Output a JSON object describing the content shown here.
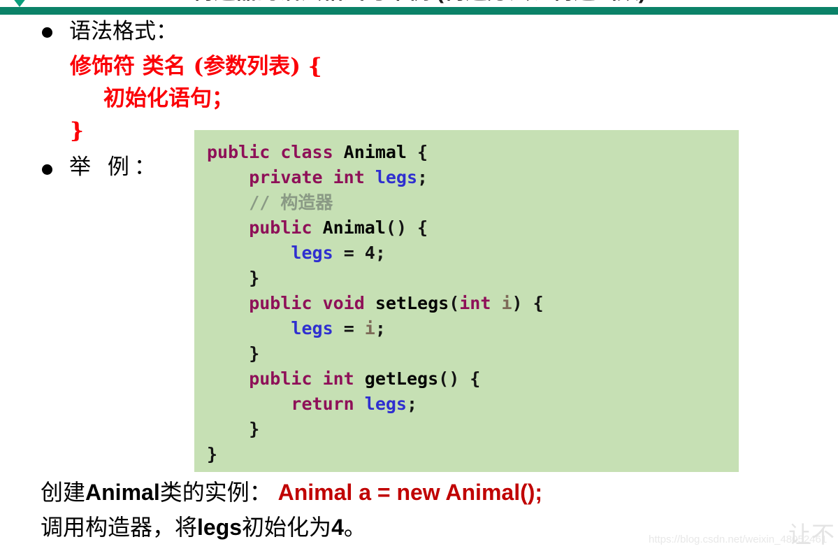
{
  "slide": {
    "title_clipped": "构造器的语法格式与举例 (构造方法、构造函数)",
    "accent_color": "#0b8268",
    "red_color": "#fb0007",
    "code_bg_color": "#c6e0b4",
    "dark_red_color": "#c00000"
  },
  "bullets": {
    "syntax_label": "语法格式：",
    "example_label": "举 例："
  },
  "syntax_template": {
    "line1": "修饰符  类名 (参数列表) {",
    "line2": "初始化语句；",
    "line3": "}"
  },
  "code": {
    "language": "java",
    "lines": [
      [
        {
          "t": "public class ",
          "c": "kw"
        },
        {
          "t": "Animal ",
          "c": "fn"
        },
        {
          "t": "{",
          "c": "plain"
        }
      ],
      [
        {
          "t": "    private int ",
          "c": "kw"
        },
        {
          "t": "legs",
          "c": "var"
        },
        {
          "t": ";",
          "c": "plain"
        }
      ],
      [
        {
          "t": "    // 构造器",
          "c": "comment"
        }
      ],
      [
        {
          "t": "    public ",
          "c": "kw"
        },
        {
          "t": "Animal",
          "c": "fn"
        },
        {
          "t": "() {",
          "c": "plain"
        }
      ],
      [
        {
          "t": "        ",
          "c": "plain"
        },
        {
          "t": "legs",
          "c": "var"
        },
        {
          "t": " = 4;",
          "c": "plain"
        }
      ],
      [
        {
          "t": "    }",
          "c": "plain"
        }
      ],
      [
        {
          "t": "    public void ",
          "c": "kw"
        },
        {
          "t": "setLegs",
          "c": "fn"
        },
        {
          "t": "(",
          "c": "plain"
        },
        {
          "t": "int ",
          "c": "kw"
        },
        {
          "t": "i",
          "c": "param"
        },
        {
          "t": ") {",
          "c": "plain"
        }
      ],
      [
        {
          "t": "        ",
          "c": "plain"
        },
        {
          "t": "legs",
          "c": "var"
        },
        {
          "t": " = ",
          "c": "plain"
        },
        {
          "t": "i",
          "c": "param"
        },
        {
          "t": ";",
          "c": "plain"
        }
      ],
      [
        {
          "t": "    }",
          "c": "plain"
        }
      ],
      [
        {
          "t": "    public int ",
          "c": "kw"
        },
        {
          "t": "getLegs",
          "c": "fn"
        },
        {
          "t": "() {",
          "c": "plain"
        }
      ],
      [
        {
          "t": "        return ",
          "c": "kw"
        },
        {
          "t": "legs",
          "c": "var"
        },
        {
          "t": ";",
          "c": "plain"
        }
      ],
      [
        {
          "t": "    }",
          "c": "plain"
        }
      ],
      [
        {
          "t": "}",
          "c": "plain"
        }
      ]
    ]
  },
  "description": {
    "line1": [
      {
        "t": "创建",
        "s": "cn"
      },
      {
        "t": "Animal",
        "s": "bold"
      },
      {
        "t": "类的实例：",
        "s": "cn"
      },
      {
        "t": " Animal  a = new Animal();",
        "s": "red"
      }
    ],
    "line2": [
      {
        "t": "调用构造器，将",
        "s": "cn"
      },
      {
        "t": "legs",
        "s": "bold"
      },
      {
        "t": "初始化为",
        "s": "cn"
      },
      {
        "t": "4",
        "s": "bold"
      },
      {
        "t": "。",
        "s": "cn"
      }
    ]
  },
  "watermark": {
    "url": "https://blog.csdn.net/weixin_48052461",
    "logo_text": "让不"
  }
}
